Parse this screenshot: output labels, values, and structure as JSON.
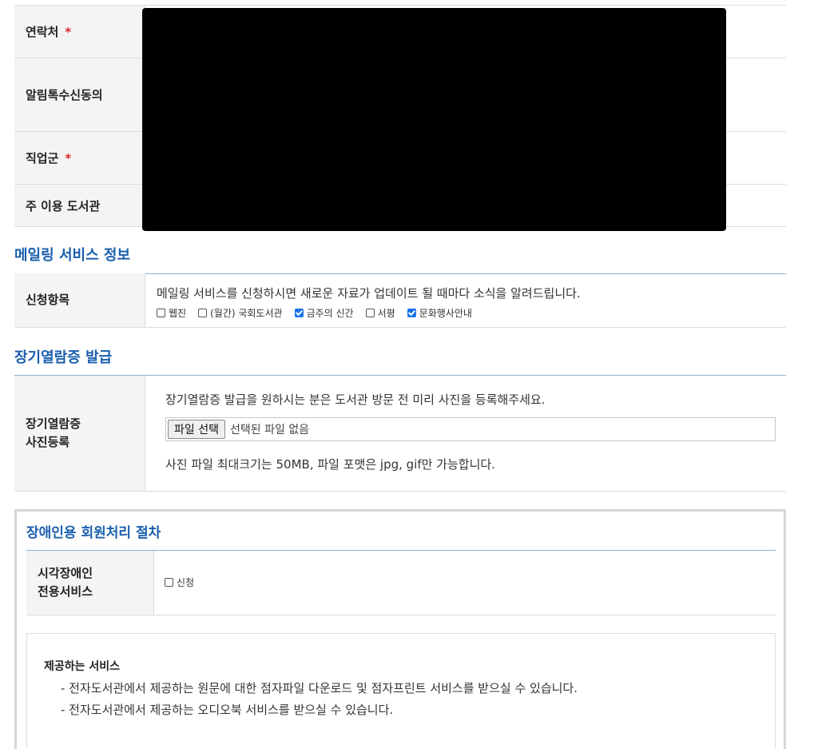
{
  "member_form": {
    "rows": [
      {
        "label": "연락처",
        "required": true
      },
      {
        "label": "알림톡수신동의",
        "required": false
      },
      {
        "label": "직업군",
        "required": true
      },
      {
        "label": "주 이용 도서관",
        "required": false
      }
    ],
    "required_mark": "*"
  },
  "mailing": {
    "section_title": "메일링 서비스 정보",
    "row_label": "신청항목",
    "description": "메일링 서비스를 신청하시면 새로운 자료가 업데이트 될 때마다 소식을 알려드립니다.",
    "options": [
      {
        "label": "웹진",
        "checked": false
      },
      {
        "label": "(월간) 국회도서관",
        "checked": false
      },
      {
        "label": "금주의 신간",
        "checked": true
      },
      {
        "label": "서평",
        "checked": false
      },
      {
        "label": "문화행사안내",
        "checked": true
      }
    ]
  },
  "library_card": {
    "section_title": "장기열람증 발급",
    "row_label_line1": "장기열람증",
    "row_label_line2": "사진등록",
    "description": "장기열람증 발급을 원하시는 분은 도서관 방문 전 미리 사진을 등록해주세요.",
    "file_button": "파일 선택",
    "file_status": "선택된 파일 없음",
    "note": "사진 파일 최대크기는 50MB, 파일 포맷은 jpg, gif만 가능합니다."
  },
  "disability": {
    "section_title": "장애인용 회원처리 절차",
    "row_label_line1": "시각장애인",
    "row_label_line2": "전용서비스",
    "apply_label": "신청",
    "apply_checked": false,
    "services_title": "제공하는 서비스",
    "services": [
      "- 전자도서관에서 제공하는 원문에 대한 점자파일 다운로드 및 점자프린트 서비스를 받으실 수 있습니다.",
      "- 전자도서관에서 제공하는 오디오북 서비스를 받으실 수 있습니다."
    ]
  },
  "colors": {
    "accent_blue": "#1b5fae",
    "required_red": "#e0262b",
    "checkbox_checked": "#1a73e8"
  }
}
